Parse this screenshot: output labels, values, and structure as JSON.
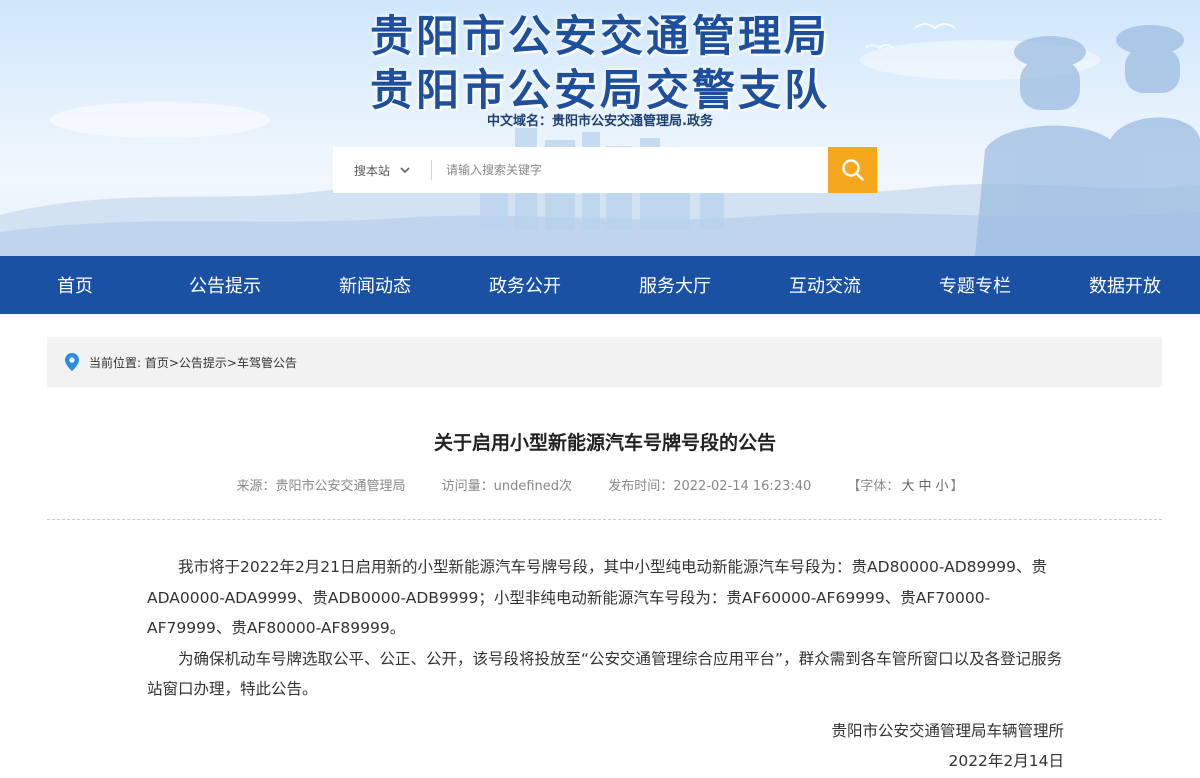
{
  "header": {
    "title_line1": "贵阳市公安交通管理局",
    "title_line2": "贵阳市公安局交警支队",
    "domain_label": "中文域名：贵阳市公安交通管理局.政务"
  },
  "search": {
    "scope": "搜本站",
    "placeholder": "请输入搜索关键字",
    "button_color": "#f5a81c"
  },
  "nav": {
    "items": [
      {
        "label": "首页"
      },
      {
        "label": "公告提示"
      },
      {
        "label": "新闻动态"
      },
      {
        "label": "政务公开"
      },
      {
        "label": "服务大厅"
      },
      {
        "label": "互动交流"
      },
      {
        "label": "专题专栏"
      },
      {
        "label": "数据开放"
      }
    ],
    "background": "#1a51a3"
  },
  "breadcrumb": {
    "text": "当前位置: 首页>公告提示>车驾管公告"
  },
  "article": {
    "title": "关于启用小型新能源汽车号牌号段的公告",
    "meta": {
      "source": "来源：贵阳市公安交通管理局",
      "views": "访问量：undefined次",
      "published": "发布时间：2022-02-14 16:23:40",
      "font_prefix": "【字体：",
      "font_large": "大",
      "font_medium": "中",
      "font_small": "小",
      "font_suffix": "】"
    },
    "paragraphs": [
      "我市将于2022年2月21日启用新的小型新能源汽车号牌号段，其中小型纯电动新能源汽车号段为：贵AD80000-AD89999、贵ADA0000-ADA9999、贵ADB0000-ADB9999；小型非纯电动新能源汽车号段为：贵AF60000-AF69999、贵AF70000-AF79999、贵AF80000-AF89999。",
      "为确保机动车号牌选取公平、公正、公开，该号段将投放至“公安交通管理综合应用平台”，群众需到各车管所窗口以及各登记服务站窗口办理，特此公告。"
    ],
    "signature": "贵阳市公安交通管理局车辆管理所",
    "date": "2022年2月14日"
  }
}
